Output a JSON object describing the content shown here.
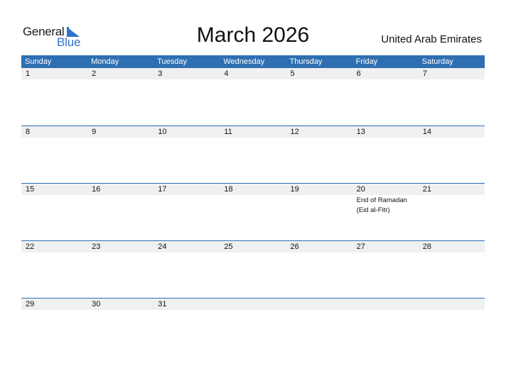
{
  "logo": {
    "part1": "General",
    "part2": "Blue"
  },
  "header": {
    "title": "March 2026",
    "country": "United Arab Emirates"
  },
  "colors": {
    "header_bg": "#2e6fb2",
    "row_band": "#f0f0f0",
    "logo_blue": "#2e75c9"
  },
  "weekdays": [
    "Sunday",
    "Monday",
    "Tuesday",
    "Wednesday",
    "Thursday",
    "Friday",
    "Saturday"
  ],
  "weeks": [
    {
      "days": [
        {
          "n": "1"
        },
        {
          "n": "2"
        },
        {
          "n": "3"
        },
        {
          "n": "4"
        },
        {
          "n": "5"
        },
        {
          "n": "6"
        },
        {
          "n": "7"
        }
      ]
    },
    {
      "days": [
        {
          "n": "8"
        },
        {
          "n": "9"
        },
        {
          "n": "10"
        },
        {
          "n": "11"
        },
        {
          "n": "12"
        },
        {
          "n": "13"
        },
        {
          "n": "14"
        }
      ]
    },
    {
      "days": [
        {
          "n": "15"
        },
        {
          "n": "16"
        },
        {
          "n": "17"
        },
        {
          "n": "18"
        },
        {
          "n": "19"
        },
        {
          "n": "20",
          "event": "End of Ramadan (Eid al-Fitr)"
        },
        {
          "n": "21"
        }
      ]
    },
    {
      "days": [
        {
          "n": "22"
        },
        {
          "n": "23"
        },
        {
          "n": "24"
        },
        {
          "n": "25"
        },
        {
          "n": "26"
        },
        {
          "n": "27"
        },
        {
          "n": "28"
        }
      ]
    },
    {
      "days": [
        {
          "n": "29"
        },
        {
          "n": "30"
        },
        {
          "n": "31"
        },
        {
          "n": ""
        },
        {
          "n": ""
        },
        {
          "n": ""
        },
        {
          "n": ""
        }
      ]
    }
  ]
}
